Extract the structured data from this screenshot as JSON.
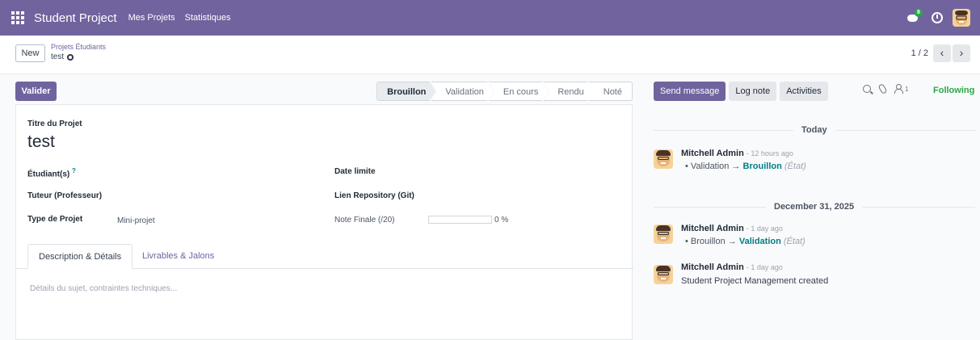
{
  "navbar": {
    "brand": "Student Project",
    "menu": [
      "Mes Projets",
      "Statistiques"
    ],
    "chat_badge": "8"
  },
  "control_panel": {
    "new_label": "New",
    "breadcrumb_parent": "Projets Étudiants",
    "breadcrumb_current": "test",
    "pager": "1 / 2"
  },
  "statusbar": {
    "action_label": "Valider",
    "stages": [
      "Brouillon",
      "Validation",
      "En cours",
      "Rendu",
      "Noté"
    ],
    "active_stage": "Brouillon"
  },
  "form": {
    "title_label": "Titre du Projet",
    "title_value": "test",
    "students_label": "Étudiant(s)",
    "students_help": "?",
    "tutor_label": "Tuteur (Professeur)",
    "type_label": "Type de Projet",
    "type_value": "Mini-projet",
    "deadline_label": "Date limite",
    "repo_label": "Lien Repository (Git)",
    "grade_label": "Note Finale (/20)",
    "grade_value": "0 %",
    "grade_fraction": 0,
    "tabs": [
      "Description & Détails",
      "Livrables & Jalons"
    ],
    "description_placeholder": "Détails du sujet, contraintes techniques..."
  },
  "chatter": {
    "send_message": "Send message",
    "log_note": "Log note",
    "activities": "Activities",
    "followers_count": "1",
    "following": "Following",
    "sep_today": "Today",
    "sep_date": "December 31, 2025",
    "messages": [
      {
        "author": "Mitchell Admin",
        "ago": "- 12 hours ago",
        "old": "Validation",
        "arrow": "→",
        "new": "Brouillon",
        "field": "(État)"
      },
      {
        "author": "Mitchell Admin",
        "ago": "- 1 day ago",
        "old": "Brouillon",
        "arrow": "→",
        "new": "Validation",
        "field": "(État)"
      },
      {
        "author": "Mitchell Admin",
        "ago": "- 1 day ago",
        "body": "Student Project Management created"
      }
    ]
  }
}
